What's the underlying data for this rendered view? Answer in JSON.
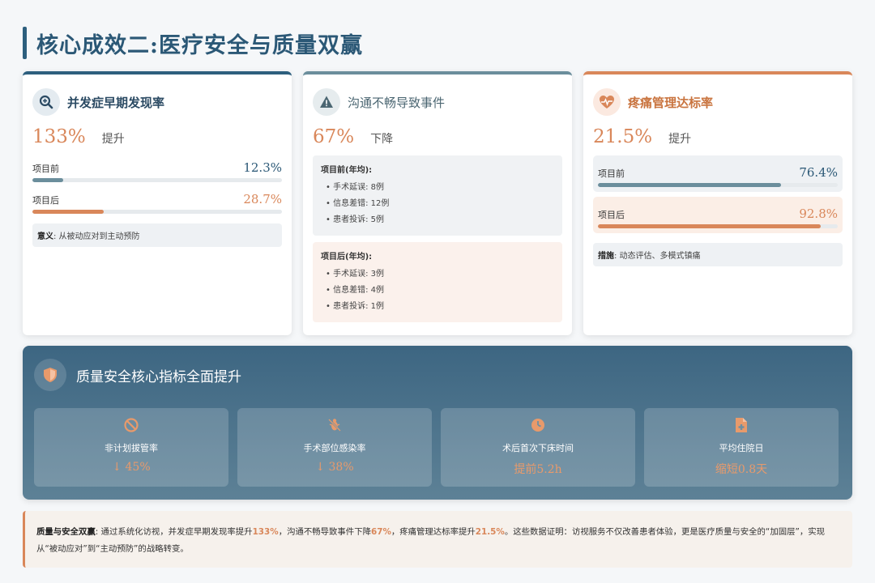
{
  "page": {
    "title": "核心成效二:医疗安全与质量双赢"
  },
  "card1": {
    "title": "并发症早期发现率",
    "big_value": "133%",
    "big_label": "提升",
    "before_label": "项目前",
    "before_value": "12.3%",
    "before_fill": 12.3,
    "after_label": "项目后",
    "after_value": "28.7%",
    "after_fill": 28.7,
    "note_label": "意义",
    "note_text": ": 从被动应对到主动预防"
  },
  "card2": {
    "title": "沟通不畅导致事件",
    "big_value": "67%",
    "big_label": "下降",
    "before_title": "项目前(年均):",
    "before_items": [
      "手术延误: 8例",
      "信息差错: 12例",
      "患者投诉: 5例"
    ],
    "after_title": "项目后(年均):",
    "after_items": [
      "手术延误: 3例",
      "信息差错: 4例",
      "患者投诉: 1例"
    ]
  },
  "card3": {
    "title": "疼痛管理达标率",
    "big_value": "21.5%",
    "big_label": "提升",
    "before_label": "项目前",
    "before_value": "76.4%",
    "before_fill": 76.4,
    "after_label": "项目后",
    "after_value": "92.8%",
    "after_fill": 92.8,
    "note_label": "措施",
    "note_text": ": 动态评估、多模式镇痛"
  },
  "panel": {
    "title": "质量安全核心指标全面提升",
    "tiles": [
      {
        "icon": "ban-icon",
        "label": "非计划拔管率",
        "value": "↓ 45%"
      },
      {
        "icon": "bug-slash-icon",
        "label": "手术部位感染率",
        "value": "↓ 38%"
      },
      {
        "icon": "clock-icon",
        "label": "术后首次下床时间",
        "value": "提前5.2h"
      },
      {
        "icon": "file-medical-icon",
        "label": "平均住院日",
        "value": "缩短0.8天"
      }
    ]
  },
  "summary": {
    "label": "质量与安全双赢",
    "t1": ": 通过系统化访视，并发症早期发现率提升",
    "v1": "133%",
    "t2": "，沟通不畅导致事件下降",
    "v2": "67%",
    "t3": "，疼痛管理达标率提升",
    "v3": "21.5%",
    "t4": "。这些数据证明：访视服务不仅改善患者体验，更是医疗质量与安全的“加固层”，实现从“被动应对”到“主动预防”的战略转变。"
  },
  "colors": {
    "primary": "#2d5f7e",
    "accent": "#d9875a",
    "muted": "#6b8e9c"
  }
}
